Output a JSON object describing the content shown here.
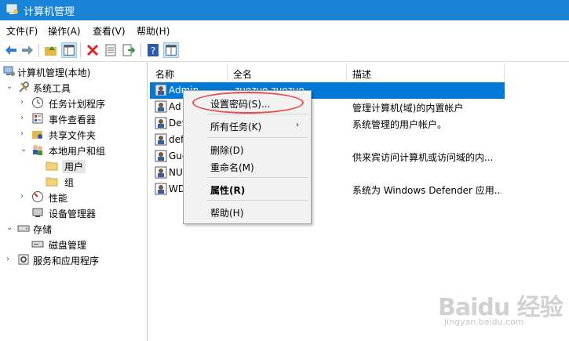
{
  "window": {
    "title": "计算机管理"
  },
  "menu": [
    "文件(F)",
    "操作(A)",
    "查看(V)",
    "帮助(H)"
  ],
  "toolbar": [
    "back-icon",
    "forward-icon",
    "up-folder-icon",
    "show-tree-icon",
    "delete-icon",
    "properties-icon",
    "export-icon",
    "help-icon",
    "view-icon"
  ],
  "tree": [
    {
      "label": "计算机管理(本地)",
      "icon": "computer-management-icon",
      "arrow": ""
    },
    {
      "label": "系统工具",
      "icon": "system-tools-icon",
      "arrow": "down"
    },
    {
      "label": "任务计划程序",
      "icon": "clock-icon",
      "arrow": "right"
    },
    {
      "label": "事件查看器",
      "icon": "event-viewer-icon",
      "arrow": "right"
    },
    {
      "label": "共享文件夹",
      "icon": "shared-folder-icon",
      "arrow": "right"
    },
    {
      "label": "本地用户和组",
      "icon": "users-group-icon",
      "arrow": "down"
    },
    {
      "label": "用户",
      "icon": "folder-icon",
      "arrow": ""
    },
    {
      "label": "组",
      "icon": "folder-icon",
      "arrow": ""
    },
    {
      "label": "性能",
      "icon": "performance-icon",
      "arrow": "right"
    },
    {
      "label": "设备管理器",
      "icon": "device-manager-icon",
      "arrow": ""
    },
    {
      "label": "存储",
      "icon": "storage-icon",
      "arrow": "down"
    },
    {
      "label": "磁盘管理",
      "icon": "disk-icon",
      "arrow": ""
    },
    {
      "label": "服务和应用程序",
      "icon": "services-icon",
      "arrow": "right"
    }
  ],
  "list": {
    "columns": [
      "名称",
      "全名",
      "描述"
    ],
    "rows": [
      {
        "name": "Admin",
        "fullname": "zuozuo zuozuo",
        "desc": ""
      },
      {
        "name": "Ad",
        "fullname": "",
        "desc": "管理计算机(域)的内置帐户"
      },
      {
        "name": "Def",
        "fullname": "",
        "desc": "系统管理的用户帐户。"
      },
      {
        "name": "def",
        "fullname": "",
        "desc": ""
      },
      {
        "name": "Gue",
        "fullname": "",
        "desc": "供来宾访问计算机或访问域的内..."
      },
      {
        "name": "NU",
        "fullname": "",
        "desc": ""
      },
      {
        "name": "WD",
        "fullname": "",
        "desc": "系统为 Windows Defender 应用..."
      }
    ]
  },
  "context_menu": {
    "set_password": "设置密码(S)...",
    "all_tasks": "所有任务(K)",
    "delete": "删除(D)",
    "rename": "重命名(M)",
    "properties": "属性(R)",
    "help": "帮助(H)"
  },
  "annotation_color": "#e74c4c",
  "selection_color": "#0078d7",
  "watermark": {
    "brand": "Baidu 经验",
    "url": "jingyan.baidu.com"
  }
}
